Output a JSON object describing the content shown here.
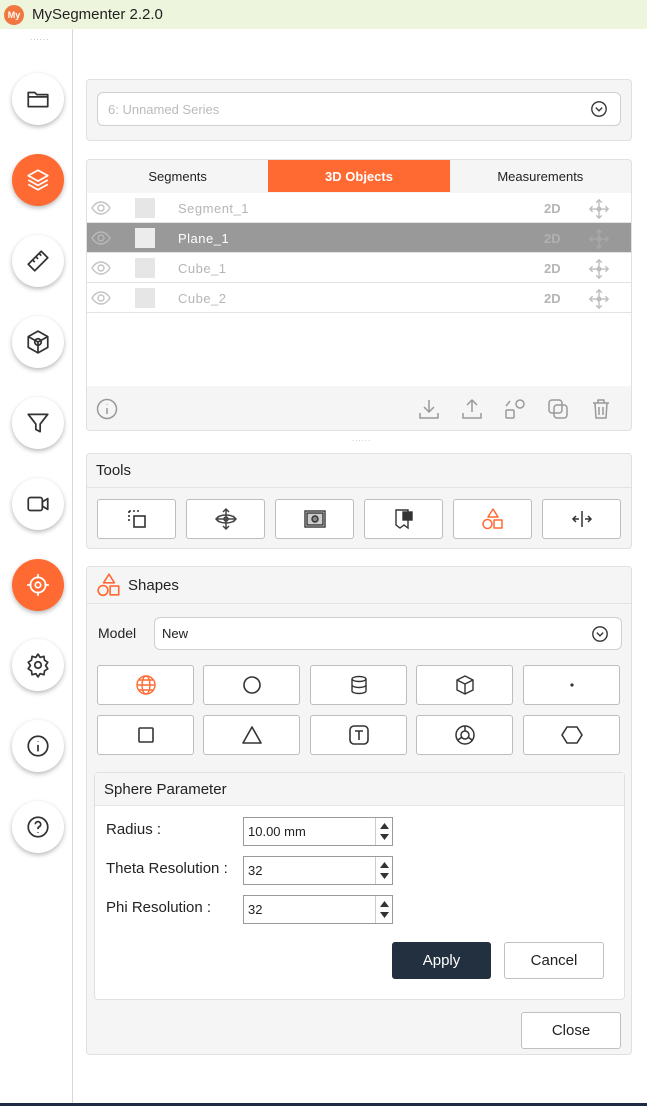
{
  "app": {
    "logo_text": "My",
    "title": "MySegmenter 2.2.0"
  },
  "sidebar": {
    "items": [
      {
        "icon": "folder-icon",
        "active": false
      },
      {
        "icon": "layers-icon",
        "active": true
      },
      {
        "icon": "ruler-icon",
        "active": false
      },
      {
        "icon": "cube-icon",
        "active": false
      },
      {
        "icon": "filter-icon",
        "active": false
      },
      {
        "icon": "video-camera-icon",
        "active": false
      },
      {
        "icon": "target-icon",
        "active": true
      },
      {
        "icon": "gear-icon",
        "active": false
      },
      {
        "icon": "info-icon",
        "active": false
      },
      {
        "icon": "help-icon",
        "active": false
      }
    ]
  },
  "series": {
    "selected": "6: Unnamed Series"
  },
  "tabs": [
    {
      "label": "Segments",
      "active": false
    },
    {
      "label": "3D Objects",
      "active": true
    },
    {
      "label": "Measurements",
      "active": false
    }
  ],
  "objects": [
    {
      "name": "Segment_1",
      "dim": "2D",
      "selected": false
    },
    {
      "name": "Plane_1",
      "dim": "2D",
      "selected": true
    },
    {
      "name": "Cube_1",
      "dim": "2D",
      "selected": false
    },
    {
      "name": "Cube_2",
      "dim": "2D",
      "selected": false
    }
  ],
  "tools": {
    "title": "Tools",
    "buttons": [
      "crop-icon",
      "move-icon",
      "image-icon",
      "mask-icon",
      "shapes-icon",
      "split-icon"
    ]
  },
  "shapes": {
    "title": "Shapes",
    "model_label": "Model",
    "model_value": "New",
    "buttons_row1": [
      "sphere-icon",
      "circle-icon",
      "cylinder-icon",
      "cube-icon",
      "point-icon"
    ],
    "buttons_row2": [
      "square-icon",
      "triangle-icon",
      "text-icon",
      "disk-icon",
      "hexagon-icon"
    ]
  },
  "sphere": {
    "title": "Sphere Parameter",
    "params": [
      {
        "label": "Radius :",
        "value": "10.00 mm"
      },
      {
        "label": "Theta Resolution :",
        "value": "32"
      },
      {
        "label": "Phi Resolution :",
        "value": "32"
      }
    ],
    "apply_label": "Apply",
    "cancel_label": "Cancel"
  },
  "close_label": "Close",
  "colors": {
    "accent": "#ff6a33",
    "dark_button": "#22303f",
    "selected_row": "#999999"
  }
}
